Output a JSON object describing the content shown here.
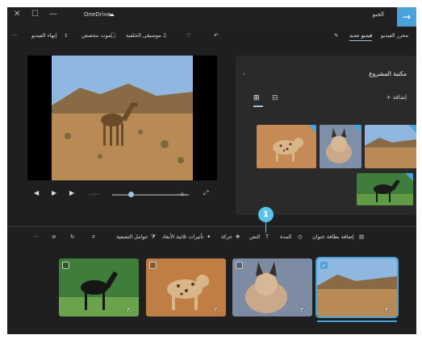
{
  "titlebar": {
    "close": "✕",
    "maximize": "☐",
    "minimize": "—",
    "cloud_label": "OneDrive",
    "project_title": "الجبو",
    "back_arrow": "→"
  },
  "toolbar": {
    "project_tab": "محرر الفيديو",
    "new_video_tab": "فيديو جديد",
    "music": "موسيقى الخلفية",
    "narration": "صوت مخصص",
    "finish": "إنهاء الفيديو",
    "more": "···"
  },
  "playback": {
    "prev": "◀",
    "play": "▶",
    "next": "▶",
    "current_time": "٠٠:٠٠",
    "total_time": "٠:٤٠",
    "fullscreen": "⤢"
  },
  "library": {
    "title": "مكتبة المشروع",
    "add": "+ إضافة",
    "chevron": "‹"
  },
  "editbar": {
    "add_title_card": "إضافة بطاقة عنوان",
    "duration": "المدة",
    "text": "النص",
    "motion": "حركة",
    "3d_effects": "تأثيرات ثلاثية الأبعاد",
    "filters": "عوامل التصفية",
    "more": "···"
  },
  "callout": {
    "number": "1"
  },
  "clips": [
    {
      "duration": "٣،٠"
    },
    {
      "duration": "٣،٠"
    },
    {
      "duration": "٣،٠"
    },
    {
      "duration": "٣،٠"
    }
  ],
  "colors": {
    "accent": "#4aa3d8",
    "callout": "#5cc3eb",
    "background": "#1f1f1f"
  }
}
